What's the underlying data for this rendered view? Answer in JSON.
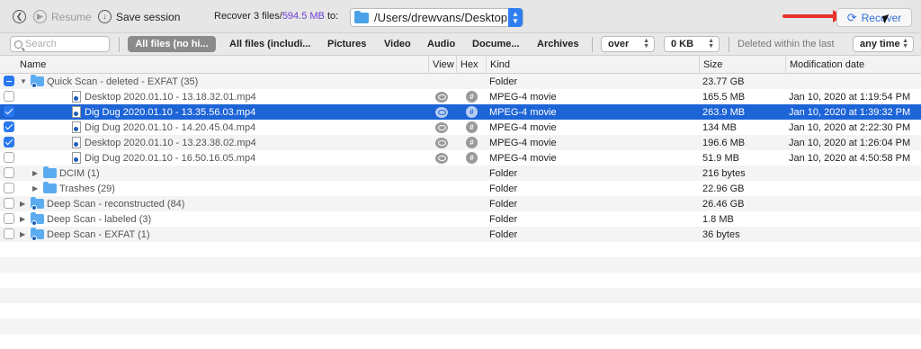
{
  "toolbar": {
    "back_icon": "chevron-left-icon",
    "resume_label": "Resume",
    "save_session_label": "Save session",
    "recover_summary_prefix": "Recover 3 files/",
    "recover_summary_size": "594.5 MB",
    "recover_summary_suffix": " to:",
    "destination_path": "/Users/drewvans/Desktop",
    "recover_label": "Recover",
    "accent_color": "#2f6fd6",
    "size_color": "#6b3fd6"
  },
  "filters": {
    "search_placeholder": "Search",
    "tabs": [
      {
        "label": "All files (no hi...",
        "active": true
      },
      {
        "label": "All files (includi...",
        "active": false
      },
      {
        "label": "Pictures",
        "active": false
      },
      {
        "label": "Video",
        "active": false
      },
      {
        "label": "Audio",
        "active": false
      },
      {
        "label": "Docume...",
        "active": false
      },
      {
        "label": "Archives",
        "active": false
      }
    ],
    "size_operator": "over",
    "size_value": "0 KB",
    "deleted_label": "Deleted within the last",
    "deleted_value": "any time"
  },
  "columns": {
    "name": "Name",
    "view": "View",
    "hex": "Hex",
    "kind": "Kind",
    "size": "Size",
    "modified": "Modification date"
  },
  "rows": [
    {
      "name": "Quick Scan - deleted - EXFAT (35)",
      "kind": "Folder",
      "size": "23.77 GB",
      "date": "",
      "check": "mixed",
      "level": 0,
      "type": "scan",
      "expanded": true
    },
    {
      "name": "Desktop 2020.01.10 - 13.18.32.01.mp4",
      "kind": "MPEG-4 movie",
      "size": "165.5 MB",
      "date": "Jan 10, 2020 at 1:19:54 PM",
      "check": "none",
      "level": 2,
      "type": "file"
    },
    {
      "name": "Dig Dug 2020.01.10 - 13.35.56.03.mp4",
      "kind": "MPEG-4 movie",
      "size": "263.9 MB",
      "date": "Jan 10, 2020 at 1:39:32 PM",
      "check": "checked",
      "level": 2,
      "type": "file",
      "selected": true
    },
    {
      "name": "Dig Dug 2020.01.10 - 14.20.45.04.mp4",
      "kind": "MPEG-4 movie",
      "size": "134 MB",
      "date": "Jan 10, 2020 at 2:22:30 PM",
      "check": "checked",
      "level": 2,
      "type": "file"
    },
    {
      "name": "Desktop 2020.01.10 - 13.23.38.02.mp4",
      "kind": "MPEG-4 movie",
      "size": "196.6 MB",
      "date": "Jan 10, 2020 at 1:26:04 PM",
      "check": "checked",
      "level": 2,
      "type": "file"
    },
    {
      "name": "Dig Dug 2020.01.10 - 16.50.16.05.mp4",
      "kind": "MPEG-4 movie",
      "size": "51.9 MB",
      "date": "Jan 10, 2020 at 4:50:58 PM",
      "check": "none",
      "level": 2,
      "type": "file"
    },
    {
      "name": "DCIM (1)",
      "kind": "Folder",
      "size": "216 bytes",
      "date": "",
      "check": "none",
      "level": 1,
      "type": "folder"
    },
    {
      "name": "Trashes (29)",
      "kind": "Folder",
      "size": "22.96 GB",
      "date": "",
      "check": "none",
      "level": 1,
      "type": "folder"
    },
    {
      "name": "Deep Scan - reconstructed (84)",
      "kind": "Folder",
      "size": "26.46 GB",
      "date": "",
      "check": "none",
      "level": 0,
      "type": "scan"
    },
    {
      "name": "Deep Scan - labeled (3)",
      "kind": "Folder",
      "size": "1.8 MB",
      "date": "",
      "check": "none",
      "level": 0,
      "type": "scan"
    },
    {
      "name": "Deep Scan - EXFAT (1)",
      "kind": "Folder",
      "size": "36 bytes",
      "date": "",
      "check": "none",
      "level": 0,
      "type": "scan"
    }
  ]
}
